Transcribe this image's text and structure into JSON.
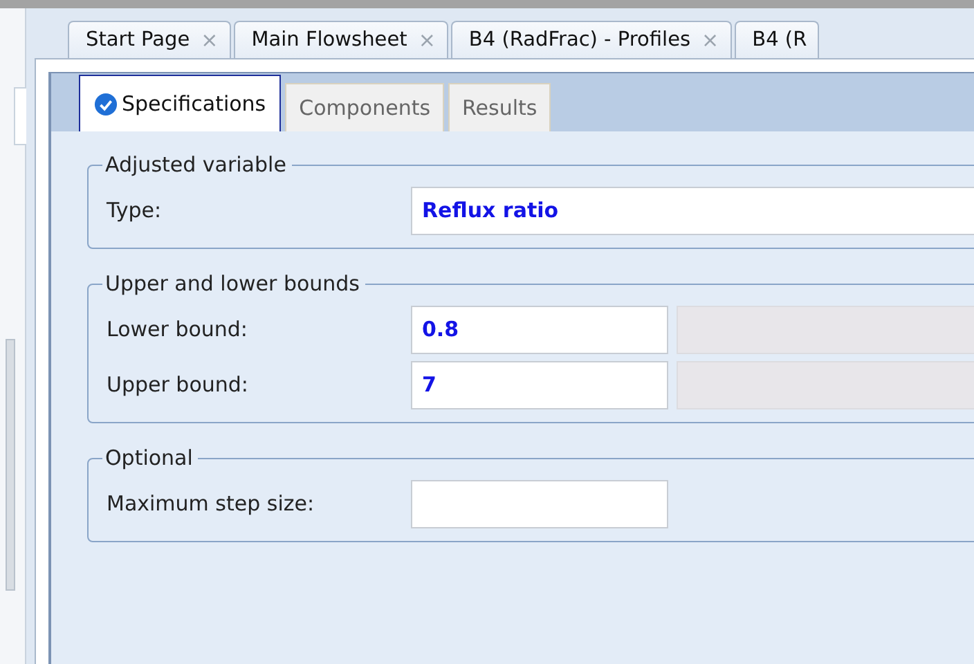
{
  "document_tabs": [
    {
      "label": "Start Page",
      "close": "×"
    },
    {
      "label": "Main Flowsheet",
      "close": "×"
    },
    {
      "label": "B4 (RadFrac) - Profiles",
      "close": "×"
    },
    {
      "label": "B4 (R"
    }
  ],
  "form_tabs": [
    {
      "label": "Specifications",
      "selected": true,
      "complete": true
    },
    {
      "label": "Components",
      "selected": false,
      "complete": false
    },
    {
      "label": "Results",
      "selected": false,
      "complete": false
    }
  ],
  "groups": [
    {
      "title": "Adjusted variable",
      "rows": [
        {
          "label": "Type:",
          "kind": "wide",
          "value": "Reflux ratio"
        }
      ]
    },
    {
      "title": "Upper and lower bounds",
      "rows": [
        {
          "label": "Lower bound:",
          "kind": "bound",
          "value": "0.8"
        },
        {
          "label": "Upper bound:",
          "kind": "bound",
          "value": "7"
        }
      ]
    },
    {
      "title": "Optional",
      "rows": [
        {
          "label": "Maximum step size:",
          "kind": "short"
        }
      ]
    }
  ]
}
